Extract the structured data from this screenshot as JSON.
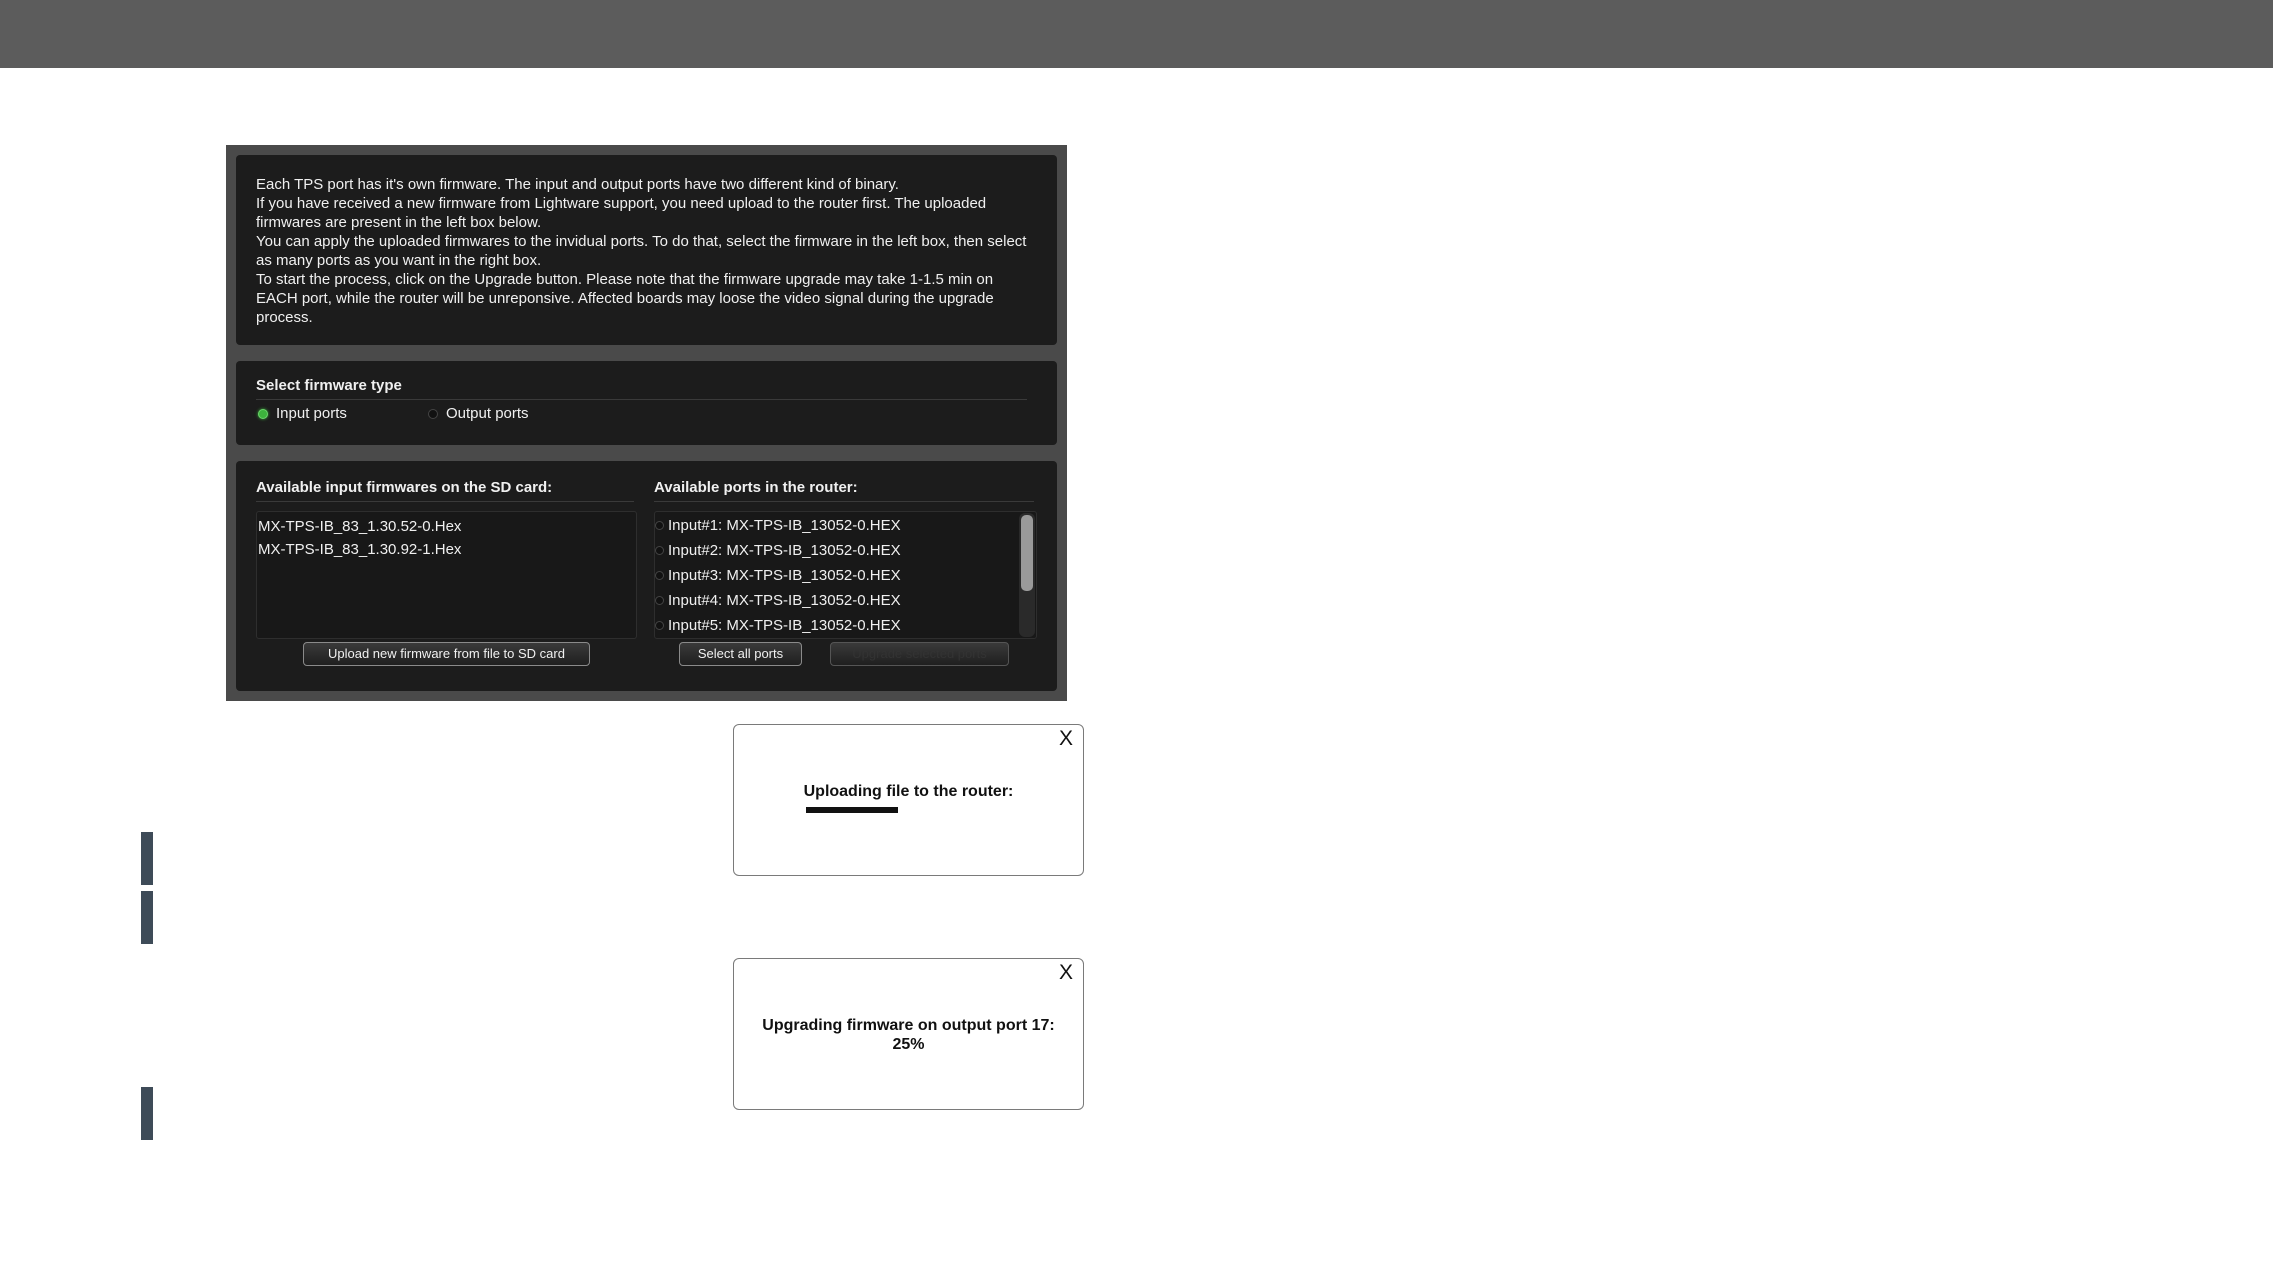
{
  "info": {
    "lines": [
      "Each TPS port has it's own firmware. The input and output ports have two different kind of binary.",
      "If you have received a new firmware from Lightware support, you need upload to the router first. The uploaded firmwares are present in the left box below.",
      "You can apply the uploaded firmwares to the invidual ports. To do that, select the firmware in the left box, then select as many ports as you want in the right box.",
      "To start the process, click on the Upgrade button. Please note that the firmware upgrade may take 1-1.5 min on EACH port, while the router will be unreponsive. Affected boards may loose the video signal during the upgrade process."
    ]
  },
  "firmware_type": {
    "title": "Select firmware type",
    "options": [
      {
        "label": "Input ports",
        "selected": true
      },
      {
        "label": "Output ports",
        "selected": false
      }
    ]
  },
  "firmwares": {
    "title": "Available input firmwares on the SD card:",
    "items": [
      "MX-TPS-IB_83_1.30.52-0.Hex",
      "MX-TPS-IB_83_1.30.92-1.Hex"
    ],
    "upload_button": "Upload new firmware from file to SD card"
  },
  "ports": {
    "title": "Available ports in the router:",
    "items": [
      "Input#1: MX-TPS-IB_13052-0.HEX",
      "Input#2: MX-TPS-IB_13052-0.HEX",
      "Input#3: MX-TPS-IB_13052-0.HEX",
      "Input#4: MX-TPS-IB_13052-0.HEX",
      "Input#5: MX-TPS-IB_13052-0.HEX"
    ],
    "select_all_button": "Select all ports",
    "upgrade_button": "Upgrade selected ports"
  },
  "dialog_upload": {
    "close": "X",
    "text": "Uploading file to the router:",
    "progress": 0.45
  },
  "dialog_upgrade": {
    "close": "X",
    "text": "Upgrading firmware on output port 17:",
    "percent": "25%"
  },
  "colors": {
    "topbar": "#5c5c5c",
    "panel_bg": "#4a4a4a",
    "section_bg": "#1c1c1c",
    "radio_selected": "#3db33d",
    "side_marker": "#3e4b58"
  }
}
